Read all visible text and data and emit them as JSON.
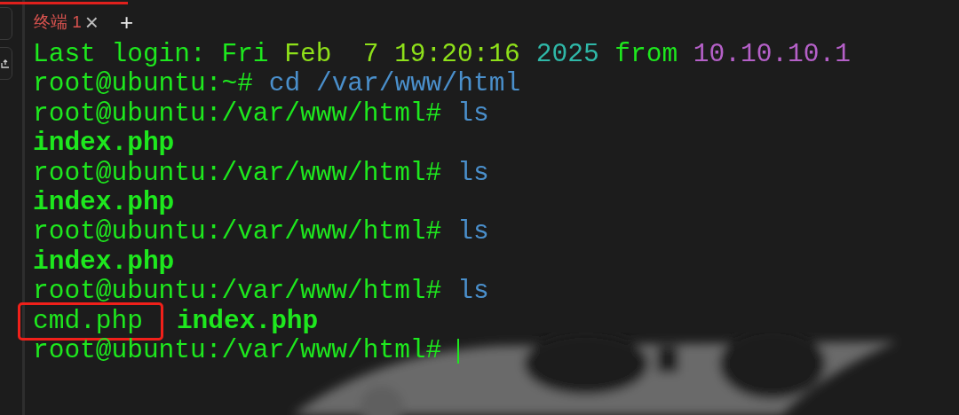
{
  "tabs": [
    {
      "label": "终端",
      "number": "1",
      "close": "×",
      "selected": true
    }
  ],
  "new_tab": "+",
  "terminal": {
    "cursor": true,
    "lines": [
      [
        {
          "kind": "info",
          "text": "Last login: Fri "
        },
        {
          "kind": "time",
          "text": "Feb  7 19:20:16"
        },
        {
          "kind": "year",
          "text": "2025"
        },
        {
          "kind": "info",
          "text": " from "
        },
        {
          "kind": "host",
          "text": "10.10.10.1"
        }
      ],
      [
        {
          "kind": "prompt",
          "text": "root@ubuntu:~#"
        },
        {
          "kind": "command",
          "text": "cd /var/www/html"
        }
      ],
      [
        {
          "kind": "prompt",
          "text": "root@ubuntu:/var/www/html#"
        },
        {
          "kind": "command",
          "text": "ls"
        }
      ],
      [
        {
          "kind": "output",
          "text": "index.php"
        }
      ],
      [
        {
          "kind": "prompt",
          "text": "root@ubuntu:/var/www/html#"
        },
        {
          "kind": "command",
          "text": "ls"
        }
      ],
      [
        {
          "kind": "output",
          "text": "index.php"
        }
      ],
      [
        {
          "kind": "prompt",
          "text": "root@ubuntu:/var/www/html#"
        },
        {
          "kind": "command",
          "text": "ls"
        }
      ],
      [
        {
          "kind": "output",
          "text": "index.php"
        }
      ],
      [
        {
          "kind": "prompt",
          "text": "root@ubuntu:/var/www/html#"
        },
        {
          "kind": "command",
          "text": "ls"
        }
      ],
      [
        {
          "kind": "file",
          "text": "cmd.php",
          "highlighted": true
        },
        {
          "kind": "output",
          "text": "index.php"
        }
      ],
      [
        {
          "kind": "prompt",
          "text": "root@ubuntu:/var/www/html#"
        }
      ]
    ]
  }
}
